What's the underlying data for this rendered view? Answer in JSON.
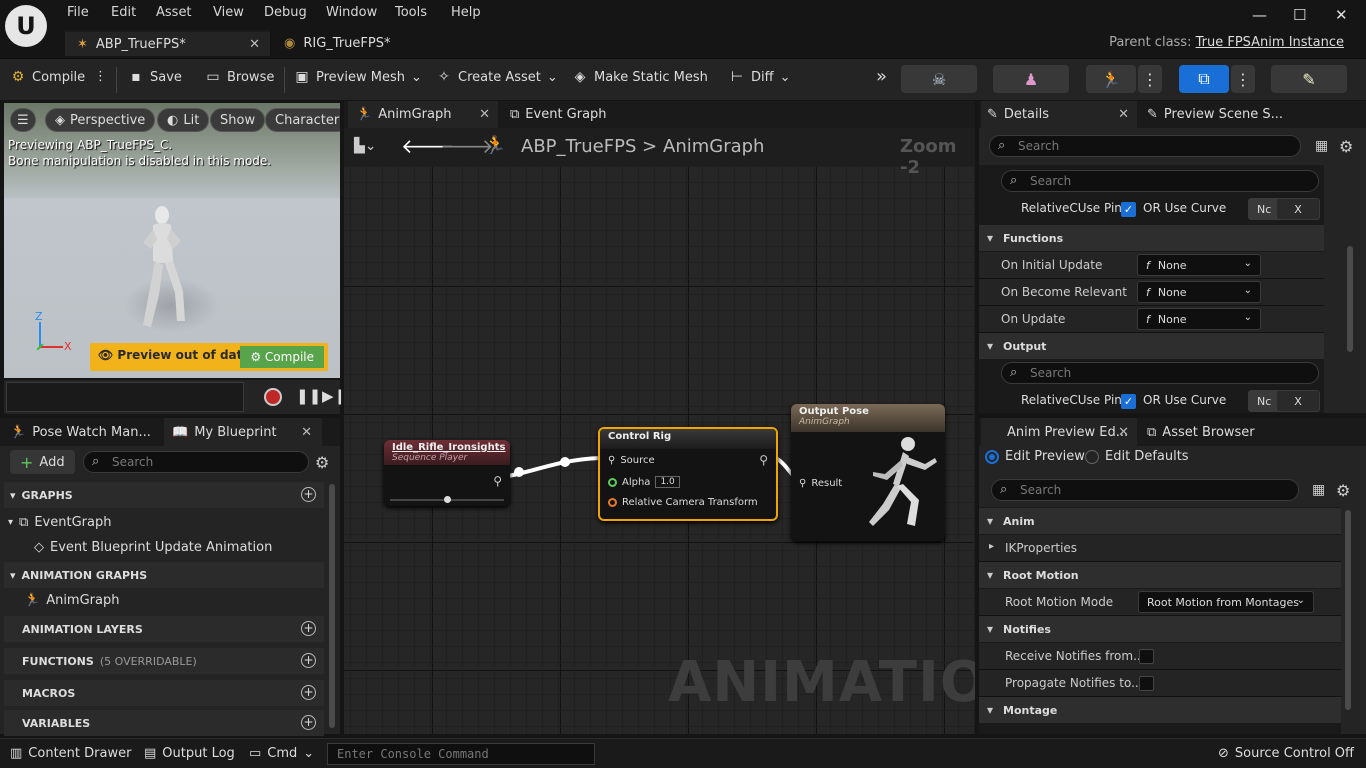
{
  "menu": {
    "items": [
      "File",
      "Edit",
      "Asset",
      "View",
      "Debug",
      "Window",
      "Tools",
      "Help"
    ]
  },
  "tabs": {
    "doc1": "ABP_TrueFPS*",
    "doc2": "RIG_TrueFPS*",
    "parent_label": "Parent class:",
    "parent_value": "True FPSAnim Instance"
  },
  "toolbar": {
    "compile": "Compile",
    "save": "Save",
    "browse": "Browse",
    "preview_mesh": "Preview Mesh",
    "create_asset": "Create Asset",
    "make_static_mesh": "Make Static Mesh",
    "diff": "Diff"
  },
  "viewport": {
    "perspective": "Perspective",
    "lit": "Lit",
    "show": "Show",
    "character": "Character",
    "msg1": "Previewing ABP_TrueFPS_C.",
    "msg2": "Bone manipulation is disabled in this mode.",
    "out_of_date": "Preview out of date",
    "compile": "Compile",
    "axis_z": "Z",
    "axis_x": "X"
  },
  "left": {
    "tab_pose_watch": "Pose Watch Man...",
    "tab_my_blueprint": "My Blueprint",
    "add": "Add",
    "search_placeholder": "Search",
    "graphs": "GRAPHS",
    "event_graph": "EventGraph",
    "event_bp_update": "Event Blueprint Update Animation",
    "anim_graphs": "ANIMATION GRAPHS",
    "anim_graph": "AnimGraph",
    "anim_layers": "ANIMATION LAYERS",
    "functions": "FUNCTIONS",
    "functions_note": "(5 OVERRIDABLE)",
    "macros": "MACROS",
    "variables": "VARIABLES"
  },
  "graph": {
    "tab_anim": "AnimGraph",
    "tab_event": "Event Graph",
    "crumb_root": "ABP_TrueFPS",
    "crumb_sep": ">",
    "crumb_leaf": "AnimGraph",
    "zoom": "Zoom -2",
    "watermark": "ANIMATION",
    "node_seq_title": "Idle_Rifle_Ironsights",
    "node_seq_sub": "Sequence Player",
    "node_rig_title": "Control Rig",
    "pin_source": "Source",
    "pin_alpha": "Alpha",
    "alpha_value": "1.0",
    "pin_rel_cam": "Relative Camera Transform",
    "node_out_title": "Output Pose",
    "node_out_sub": "AnimGraph",
    "pin_result": "Result"
  },
  "details": {
    "tab_details": "Details",
    "tab_preview": "Preview Scene S...",
    "search": "Search",
    "relcuse_label": "RelativeCUse Pin",
    "or_use_curve": "OR Use Curve",
    "curve_combo": "Nc",
    "x_button": "X",
    "sec_functions": "Functions",
    "on_initial_update": "On Initial Update",
    "on_become_relevant": "On Become Relevant",
    "on_update": "On Update",
    "none": "None",
    "fn_glyph": "f",
    "sec_output": "Output"
  },
  "animpreview": {
    "tab_anim_preview": "Anim Preview Ed...",
    "tab_asset_browser": "Asset Browser",
    "edit_preview": "Edit Preview",
    "edit_defaults": "Edit Defaults",
    "search": "Search",
    "sec_anim": "Anim",
    "ik_properties": "IKProperties",
    "sec_root_motion": "Root Motion",
    "root_motion_mode": "Root Motion Mode",
    "root_motion_value": "Root Motion from Montages",
    "sec_notifies": "Notifies",
    "receive_notifies": "Receive Notifies from...",
    "propagate_notifies": "Propagate Notifies to...",
    "sec_montage": "Montage"
  },
  "status": {
    "content_drawer": "Content Drawer",
    "output_log": "Output Log",
    "cmd": "Cmd",
    "console_placeholder": "Enter Console Command",
    "source_control": "Source Control Off"
  },
  "colors": {
    "accent_blue": "#1a6fd6",
    "warning": "#f2b21a",
    "compile_green": "#58a44a",
    "node_select": "#f0a500"
  }
}
